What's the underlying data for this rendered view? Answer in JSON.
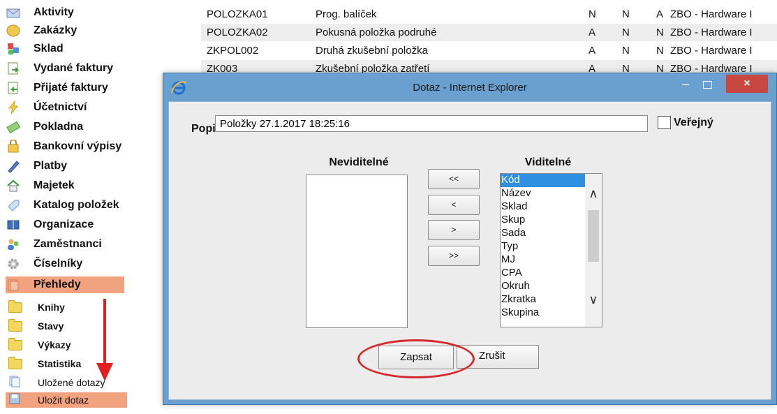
{
  "nav": {
    "items": [
      {
        "label": "Aktivity",
        "icon": "envelope-icon"
      },
      {
        "label": "Zakázky",
        "icon": "coins-icon"
      },
      {
        "label": "Sklad",
        "icon": "boxes-icon"
      },
      {
        "label": "Vydané faktury",
        "icon": "invoice-out-icon"
      },
      {
        "label": "Přijaté faktury",
        "icon": "invoice-in-icon"
      },
      {
        "label": "Účetnictví",
        "icon": "lightning-icon"
      },
      {
        "label": "Pokladna",
        "icon": "cash-icon"
      },
      {
        "label": "Bankovní výpisy",
        "icon": "safe-icon"
      },
      {
        "label": "Platby",
        "icon": "pen-icon"
      },
      {
        "label": "Majetek",
        "icon": "house-icon"
      },
      {
        "label": "Katalog položek",
        "icon": "tag-icon"
      },
      {
        "label": "Organizace",
        "icon": "book-icon"
      },
      {
        "label": "Zaměstnanci",
        "icon": "people-icon"
      },
      {
        "label": "Číselníky",
        "icon": "gear-icon"
      },
      {
        "label": "Přehledy",
        "icon": "folder-icon"
      }
    ],
    "sub_items": [
      {
        "label": "Knihy"
      },
      {
        "label": "Stavy"
      },
      {
        "label": "Výkazy"
      },
      {
        "label": "Statistika"
      },
      {
        "label": "Uložené dotazy"
      },
      {
        "label": "Uložit dotaz"
      }
    ]
  },
  "table": {
    "rows": [
      {
        "code": "POLOZKA01",
        "name": "Prog. balíček",
        "c1": "N",
        "c2": "N",
        "c3": "A",
        "c4": "ZBO - Hardware I"
      },
      {
        "code": "POLOZKA02",
        "name": "Pokusná položka podruhé",
        "c1": "A",
        "c2": "N",
        "c3": "N",
        "c4": "ZBO - Hardware I"
      },
      {
        "code": "ZKPOL002",
        "name": "Druhá zkušební položka",
        "c1": "A",
        "c2": "N",
        "c3": "N",
        "c4": "ZBO - Hardware I"
      },
      {
        "code": "ZK003",
        "name": "Zkušební položka zatřetí",
        "c1": "A",
        "c2": "N",
        "c3": "N",
        "c4": "ZBO - Hardware I"
      }
    ],
    "right_fragments": [
      "I",
      "I",
      "I",
      "I"
    ]
  },
  "dialog": {
    "title": "Dotaz - Internet Explorer",
    "minimize": "–",
    "close": "×",
    "popis_label": "Popis:",
    "popis_value": "Položky 27.1.2017 18:25:16",
    "public_label": "Veřejný",
    "invisible_title": "Neviditelné",
    "visible_title": "Viditelné",
    "visible_items": [
      "Kód",
      "Název",
      "Sklad",
      "Skup",
      "Sada",
      "Typ",
      "MJ",
      "CPA",
      "Okruh",
      "Zkratka",
      "Skupina"
    ],
    "selected_item": 0,
    "move_buttons": [
      "<<",
      "<",
      ">",
      ">>"
    ],
    "save_label": "Zapsat",
    "cancel_label": "Zrušit"
  },
  "colors": {
    "selection": "#f1a37f",
    "annotation": "#e02020",
    "list_selection": "#2f8fe0",
    "dialog_frame": "#6aa0d0"
  }
}
